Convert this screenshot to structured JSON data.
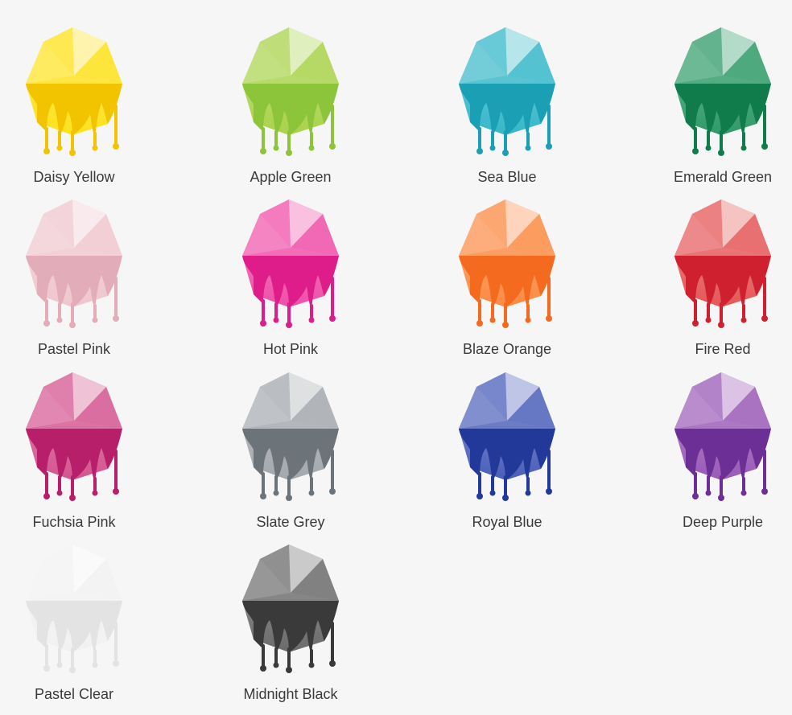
{
  "swatches": [
    {
      "label": "Daisy Yellow",
      "icon": "paint-drip-hexagon-icon",
      "color": "#fde21a",
      "dark": "#f2c400"
    },
    {
      "label": "Apple Green",
      "icon": "paint-drip-hexagon-icon",
      "color": "#a9d24b",
      "dark": "#8cc43a"
    },
    {
      "label": "Sea Blue",
      "icon": "paint-drip-hexagon-icon",
      "color": "#36b7c9",
      "dark": "#1a9fb4"
    },
    {
      "label": "Emerald Green",
      "icon": "paint-drip-hexagon-icon",
      "color": "#2f9a68",
      "dark": "#107c4b"
    },
    {
      "label": "Pastel Pink",
      "icon": "paint-drip-hexagon-icon",
      "color": "#efc6ce",
      "dark": "#e2adb9"
    },
    {
      "label": "Hot Pink",
      "icon": "paint-drip-hexagon-icon",
      "color": "#ef4fa8",
      "dark": "#de1d8a"
    },
    {
      "label": "Blaze Orange",
      "icon": "paint-drip-hexagon-icon",
      "color": "#fb8a43",
      "dark": "#f46a1e"
    },
    {
      "label": "Fire Red",
      "icon": "paint-drip-hexagon-icon",
      "color": "#e55758",
      "dark": "#cf2030"
    },
    {
      "label": "Fuchsia Pink",
      "icon": "paint-drip-hexagon-icon",
      "color": "#d4548f",
      "dark": "#b81f6b"
    },
    {
      "label": "Slate Grey",
      "icon": "paint-drip-hexagon-icon",
      "color": "#a3a8ad",
      "dark": "#6d7479"
    },
    {
      "label": "Royal Blue",
      "icon": "paint-drip-hexagon-icon",
      "color": "#4b5fb9",
      "dark": "#22399a"
    },
    {
      "label": "Deep Purple",
      "icon": "paint-drip-hexagon-icon",
      "color": "#9a5ab7",
      "dark": "#6c2f95"
    },
    {
      "label": "Pastel Clear",
      "icon": "paint-drip-hexagon-icon",
      "color": "#f1f1f1",
      "dark": "#e3e3e3"
    },
    {
      "label": "Midnight Black",
      "icon": "paint-drip-hexagon-icon",
      "color": "#6b6b6b",
      "dark": "#3a3a3a"
    }
  ]
}
